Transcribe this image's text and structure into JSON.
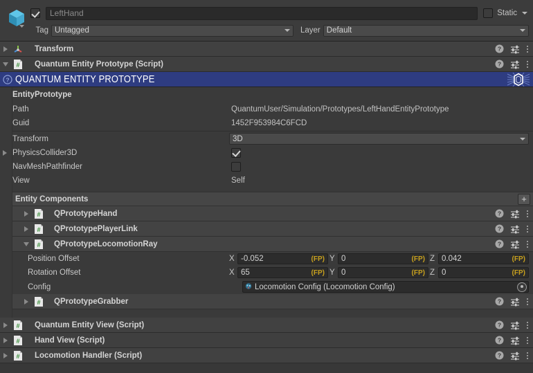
{
  "header": {
    "prefab_icon": "cube-prefab-icon",
    "enabled_checkbox": true,
    "name": "LeftHand",
    "static_label": "Static",
    "tag_label": "Tag",
    "tag_value": "Untagged",
    "layer_label": "Layer",
    "layer_value": "Default"
  },
  "components": [
    {
      "name": "Transform",
      "icon": "transform-gizmo-icon",
      "expanded": false
    },
    {
      "name": "Quantum Entity Prototype (Script)",
      "icon": "script-icon",
      "expanded": true
    }
  ],
  "quantum_banner": {
    "title": "QUANTUM ENTITY PROTOTYPE",
    "info_icon": "help-info-icon",
    "logo_icon": "quantum-hexagon-logo",
    "color": "#2e3c81"
  },
  "entity_prototype": {
    "section_label": "EntityPrototype",
    "path_label": "Path",
    "path_value": "QuantumUser/Simulation/Prototypes/LeftHandEntityPrototype",
    "guid_label": "Guid",
    "guid_value": "1452F953984C6FCD",
    "transform_label": "Transform",
    "transform_value": "3D",
    "physics_collider_label": "PhysicsCollider3D",
    "physics_collider_checked": true,
    "navmesh_label": "NavMeshPathfinder",
    "navmesh_checked": false,
    "view_label": "View",
    "view_value": "Self"
  },
  "entity_components": {
    "title": "Entity Components",
    "add_button": "+",
    "items": [
      {
        "name": "QPrototypeHand",
        "expanded": false,
        "icon": "script-icon"
      },
      {
        "name": "QPrototypePlayerLink",
        "expanded": false,
        "icon": "script-icon"
      },
      {
        "name": "QPrototypeLocomotionRay",
        "expanded": true,
        "icon": "script-icon"
      },
      {
        "name": "QPrototypeGrabber",
        "expanded": false,
        "icon": "script-icon"
      }
    ]
  },
  "locomotion_ray": {
    "position_offset": {
      "label": "Position Offset",
      "x_axis": "X",
      "x": "-0.052",
      "x_unit": "(FP)",
      "y_axis": "Y",
      "y": "0",
      "y_unit": "(FP)",
      "z_axis": "Z",
      "z": "0.042",
      "z_unit": "(FP)"
    },
    "rotation_offset": {
      "label": "Rotation Offset",
      "x_axis": "X",
      "x": "65",
      "x_unit": "(FP)",
      "y_axis": "Y",
      "y": "0",
      "y_unit": "(FP)",
      "z_axis": "Z",
      "z": "0",
      "z_unit": "(FP)"
    },
    "config": {
      "label": "Config",
      "value": "Locomotion Config (Locomotion Config)",
      "icon": "asset-config-icon",
      "picker_icon": "object-picker-icon"
    }
  },
  "bottom_components": [
    {
      "name": "Quantum Entity View (Script)",
      "icon": "script-icon",
      "expanded": false
    },
    {
      "name": "Hand View (Script)",
      "icon": "script-icon",
      "expanded": false
    },
    {
      "name": "Locomotion Handler (Script)",
      "icon": "script-icon",
      "expanded": false
    }
  ],
  "row_icons": {
    "help": "help-icon",
    "preset": "preset-icon",
    "menu": "kebab-menu-icon"
  },
  "colors": {
    "banner": "#2e3c81",
    "fp_tag": "#c8a11e",
    "background": "#383838"
  }
}
